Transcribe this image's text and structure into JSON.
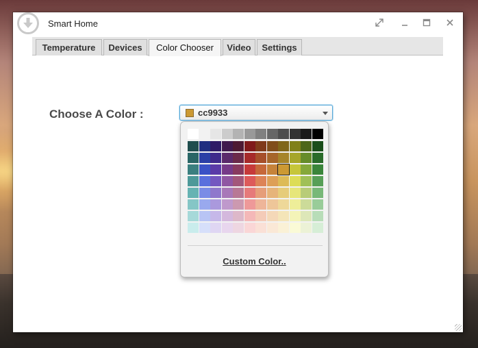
{
  "window": {
    "title": "Smart Home",
    "icon": "download-arrow-icon",
    "controls": [
      "maximize-icon",
      "minimize-icon",
      "restore-icon",
      "close-icon"
    ]
  },
  "tabs": [
    {
      "label": "Temperature",
      "active": false
    },
    {
      "label": "Devices",
      "active": false
    },
    {
      "label": "Color Chooser",
      "active": true
    },
    {
      "label": "Video",
      "active": false
    },
    {
      "label": "Settings",
      "active": false
    }
  ],
  "chooser": {
    "label": "Choose A Color :",
    "selected_value": "cc9933",
    "selected_color": "#cc9933",
    "custom_link": "Custom Color.."
  },
  "palette": [
    [
      "#ffffff",
      "#f2f2f2",
      "#e6e6e6",
      "#cccccc",
      "#b3b3b3",
      "#999999",
      "#808080",
      "#666666",
      "#4d4d4d",
      "#333333",
      "#1a1a1a",
      "#000000"
    ],
    [
      "#1f4d4d",
      "#1f2e80",
      "#2e1a66",
      "#3f1a4d",
      "#4d1a33",
      "#801a1a",
      "#803a1a",
      "#804d1a",
      "#806619",
      "#808019",
      "#4d661a",
      "#1a4d1a"
    ],
    [
      "#2a6666",
      "#2a3fa6",
      "#3f2a8c",
      "#5a2a6b",
      "#6b2a4a",
      "#a62a2a",
      "#a64f2a",
      "#a6662a",
      "#a6852a",
      "#a6a62a",
      "#668c2a",
      "#2a6b2a"
    ],
    [
      "#3a7f7f",
      "#3a52c6",
      "#5a3aa8",
      "#763a88",
      "#883a5f",
      "#c63a3a",
      "#c6683a",
      "#c6833a",
      "#cc9933",
      "#c6c63a",
      "#85a83a",
      "#3a853a"
    ],
    [
      "#4d9999",
      "#5a70dd",
      "#7457c0",
      "#9057a3",
      "#a3577a",
      "#dd5a5a",
      "#dd8357",
      "#dd9f57",
      "#ddbb57",
      "#dddd57",
      "#a0c057",
      "#579f57"
    ],
    [
      "#66b3b3",
      "#7a8ce6",
      "#8f78cc",
      "#a878b8",
      "#b87895",
      "#e67a7a",
      "#e69e7a",
      "#e6b47a",
      "#e6cc7a",
      "#e6e67a",
      "#b8cc78",
      "#78b878"
    ],
    [
      "#85c6c6",
      "#99a9ee",
      "#aa99dd",
      "#bf99cc",
      "#cc99b0",
      "#ee9999",
      "#eeb599",
      "#eec699",
      "#eed899",
      "#eeee99",
      "#ccdb99",
      "#99cc99"
    ],
    [
      "#a6d9d9",
      "#b8c4f4",
      "#c6b8e9",
      "#d4b8dd",
      "#ddb8c9",
      "#f4b8b8",
      "#f4cbb8",
      "#f4d8b8",
      "#f4e5b8",
      "#f4f4b8",
      "#dde7b8",
      "#b8ddb8"
    ],
    [
      "#c9ecec",
      "#d6dffa",
      "#dfd6f3",
      "#e8d6ee",
      "#eed6e1",
      "#fad6d6",
      "#fae0d6",
      "#fae8d6",
      "#faf1d6",
      "#fafad6",
      "#ecf2d6",
      "#d6eed6"
    ]
  ],
  "selected_cell": {
    "row": 3,
    "col": 8
  }
}
